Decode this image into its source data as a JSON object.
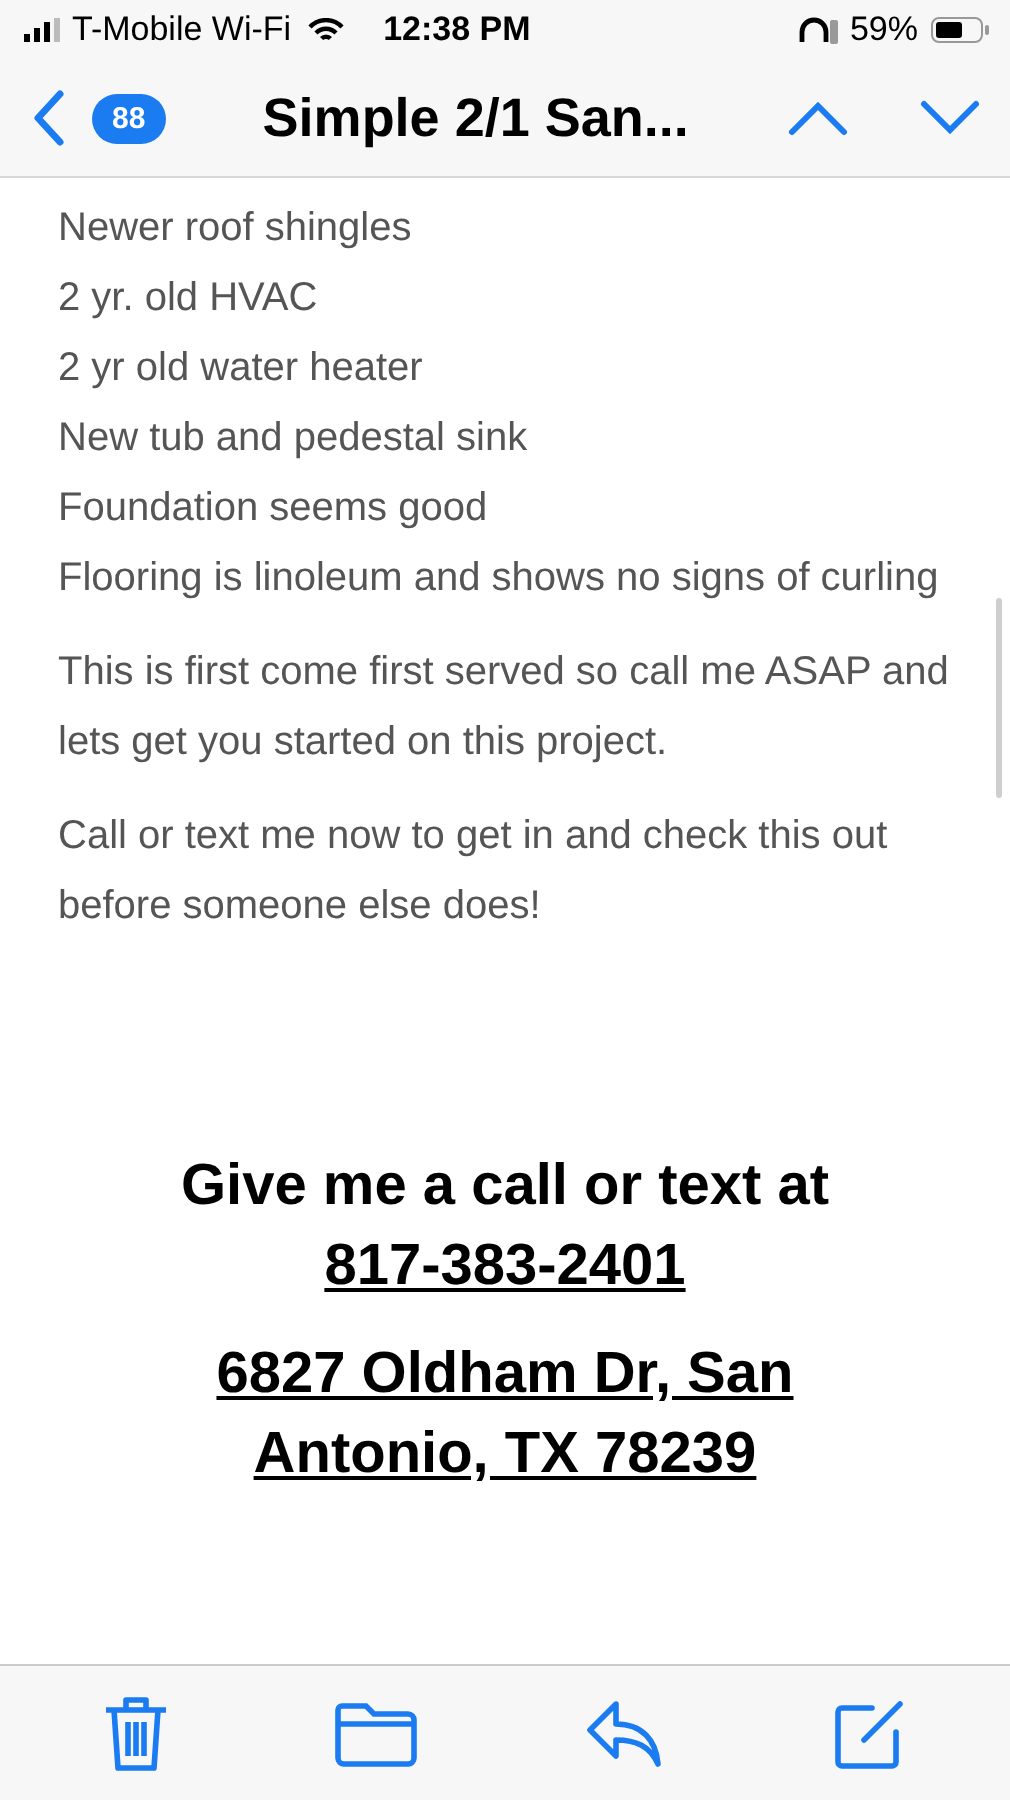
{
  "status_bar": {
    "carrier": "T-Mobile Wi-Fi",
    "time": "12:38 PM",
    "battery": "59%"
  },
  "nav": {
    "unread_count": "88",
    "title": "Simple 2/1 San..."
  },
  "body": {
    "list_lines": [
      "Newer roof shingles",
      "2 yr. old HVAC",
      "2 yr old water heater",
      "New tub and pedestal sink",
      "Foundation seems good",
      "Flooring is linoleum and shows no signs of curling"
    ],
    "paragraphs": [
      "This is first come first served so call me ASAP and lets get you started on this project.",
      "Call or text me now to get in and check this out before someone else does!"
    ]
  },
  "contact": {
    "heading": "Give me a call or text at",
    "phone": "817-383-2401",
    "address": "6827 Oldham Dr, San Antonio, TX 78239"
  }
}
